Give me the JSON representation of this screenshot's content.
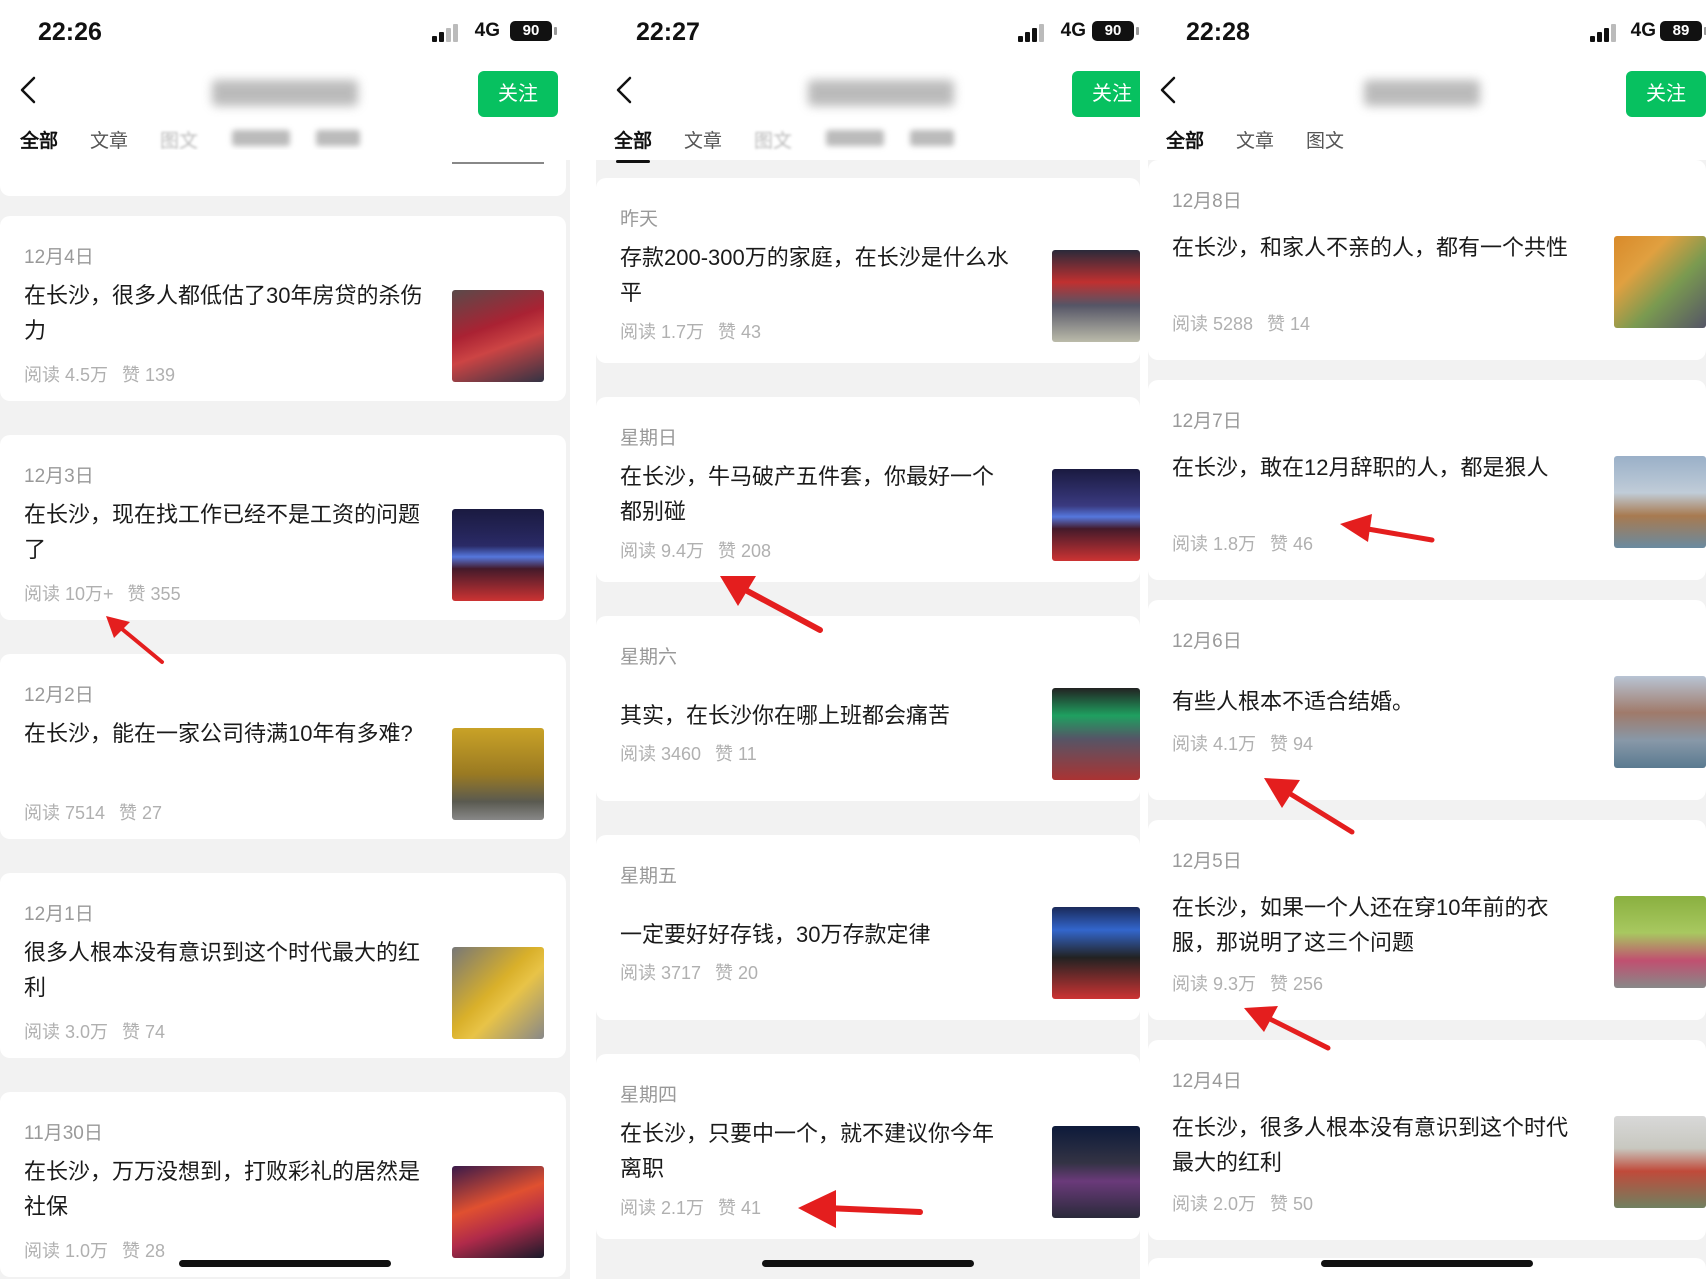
{
  "colors": {
    "follow": "#07c160",
    "arrow": "#e41e1e",
    "date": "#999999",
    "meta": "#b0b0b0"
  },
  "panels": [
    {
      "time": "22:26",
      "network": "4G",
      "battery": "90",
      "follow_label": "关注",
      "tabs": [
        "全部",
        "文章",
        "图文"
      ],
      "articles": [
        {
          "date": "12月4日",
          "title": "在长沙，很多人都低估了30年房贷的杀伤力",
          "reads": "阅读 4.5万",
          "likes": "赞 139"
        },
        {
          "date": "12月3日",
          "title": "在长沙，现在找工作已经不是工资的问题了",
          "reads": "阅读 10万+",
          "likes": "赞 355"
        },
        {
          "date": "12月2日",
          "title": "在长沙，能在一家公司待满10年有多难?",
          "reads": "阅读 7514",
          "likes": "赞 27"
        },
        {
          "date": "12月1日",
          "title": "很多人根本没有意识到这个时代最大的红利",
          "reads": "阅读 3.0万",
          "likes": "赞 74"
        },
        {
          "date": "11月30日",
          "title": "在长沙，万万没想到，打败彩礼的居然是社保",
          "reads": "阅读 1.0万",
          "likes": "赞 28"
        }
      ]
    },
    {
      "time": "22:27",
      "network": "4G",
      "battery": "90",
      "follow_label": "关注",
      "tabs": [
        "全部",
        "文章",
        "图文"
      ],
      "articles": [
        {
          "date": "昨天",
          "title": "存款200-300万的家庭，在长沙是什么水平",
          "reads": "阅读 1.7万",
          "likes": "赞 43"
        },
        {
          "date": "星期日",
          "title": "在长沙，牛马破产五件套，你最好一个都别碰",
          "reads": "阅读 9.4万",
          "likes": "赞 208"
        },
        {
          "date": "星期六",
          "title": "其实，在长沙你在哪上班都会痛苦",
          "reads": "阅读 3460",
          "likes": "赞 11"
        },
        {
          "date": "星期五",
          "title": "一定要好好存钱，30万存款定律",
          "reads": "阅读 3717",
          "likes": "赞 20"
        },
        {
          "date": "星期四",
          "title": "在长沙，只要中一个，就不建议你今年离职",
          "reads": "阅读 2.1万",
          "likes": "赞 41"
        }
      ]
    },
    {
      "time": "22:28",
      "network": "4G",
      "battery": "89",
      "follow_label": "关注",
      "tabs": [
        "全部",
        "文章",
        "图文"
      ],
      "articles": [
        {
          "date": "12月8日",
          "title": "在长沙，和家人不亲的人，都有一个共性",
          "reads": "阅读 5288",
          "likes": "赞 14"
        },
        {
          "date": "12月7日",
          "title": "在长沙，敢在12月辞职的人，都是狠人",
          "reads": "阅读 1.8万",
          "likes": "赞 46"
        },
        {
          "date": "12月6日",
          "title": "有些人根本不适合结婚。",
          "reads": "阅读 4.1万",
          "likes": "赞 94"
        },
        {
          "date": "12月5日",
          "title": "在长沙，如果一个人还在穿10年前的衣服，那说明了这三个问题",
          "reads": "阅读 9.3万",
          "likes": "赞 256"
        },
        {
          "date": "12月4日",
          "title": "在长沙，很多人根本没有意识到这个时代最大的红利",
          "reads": "阅读 2.0万",
          "likes": "赞 50"
        }
      ]
    }
  ]
}
